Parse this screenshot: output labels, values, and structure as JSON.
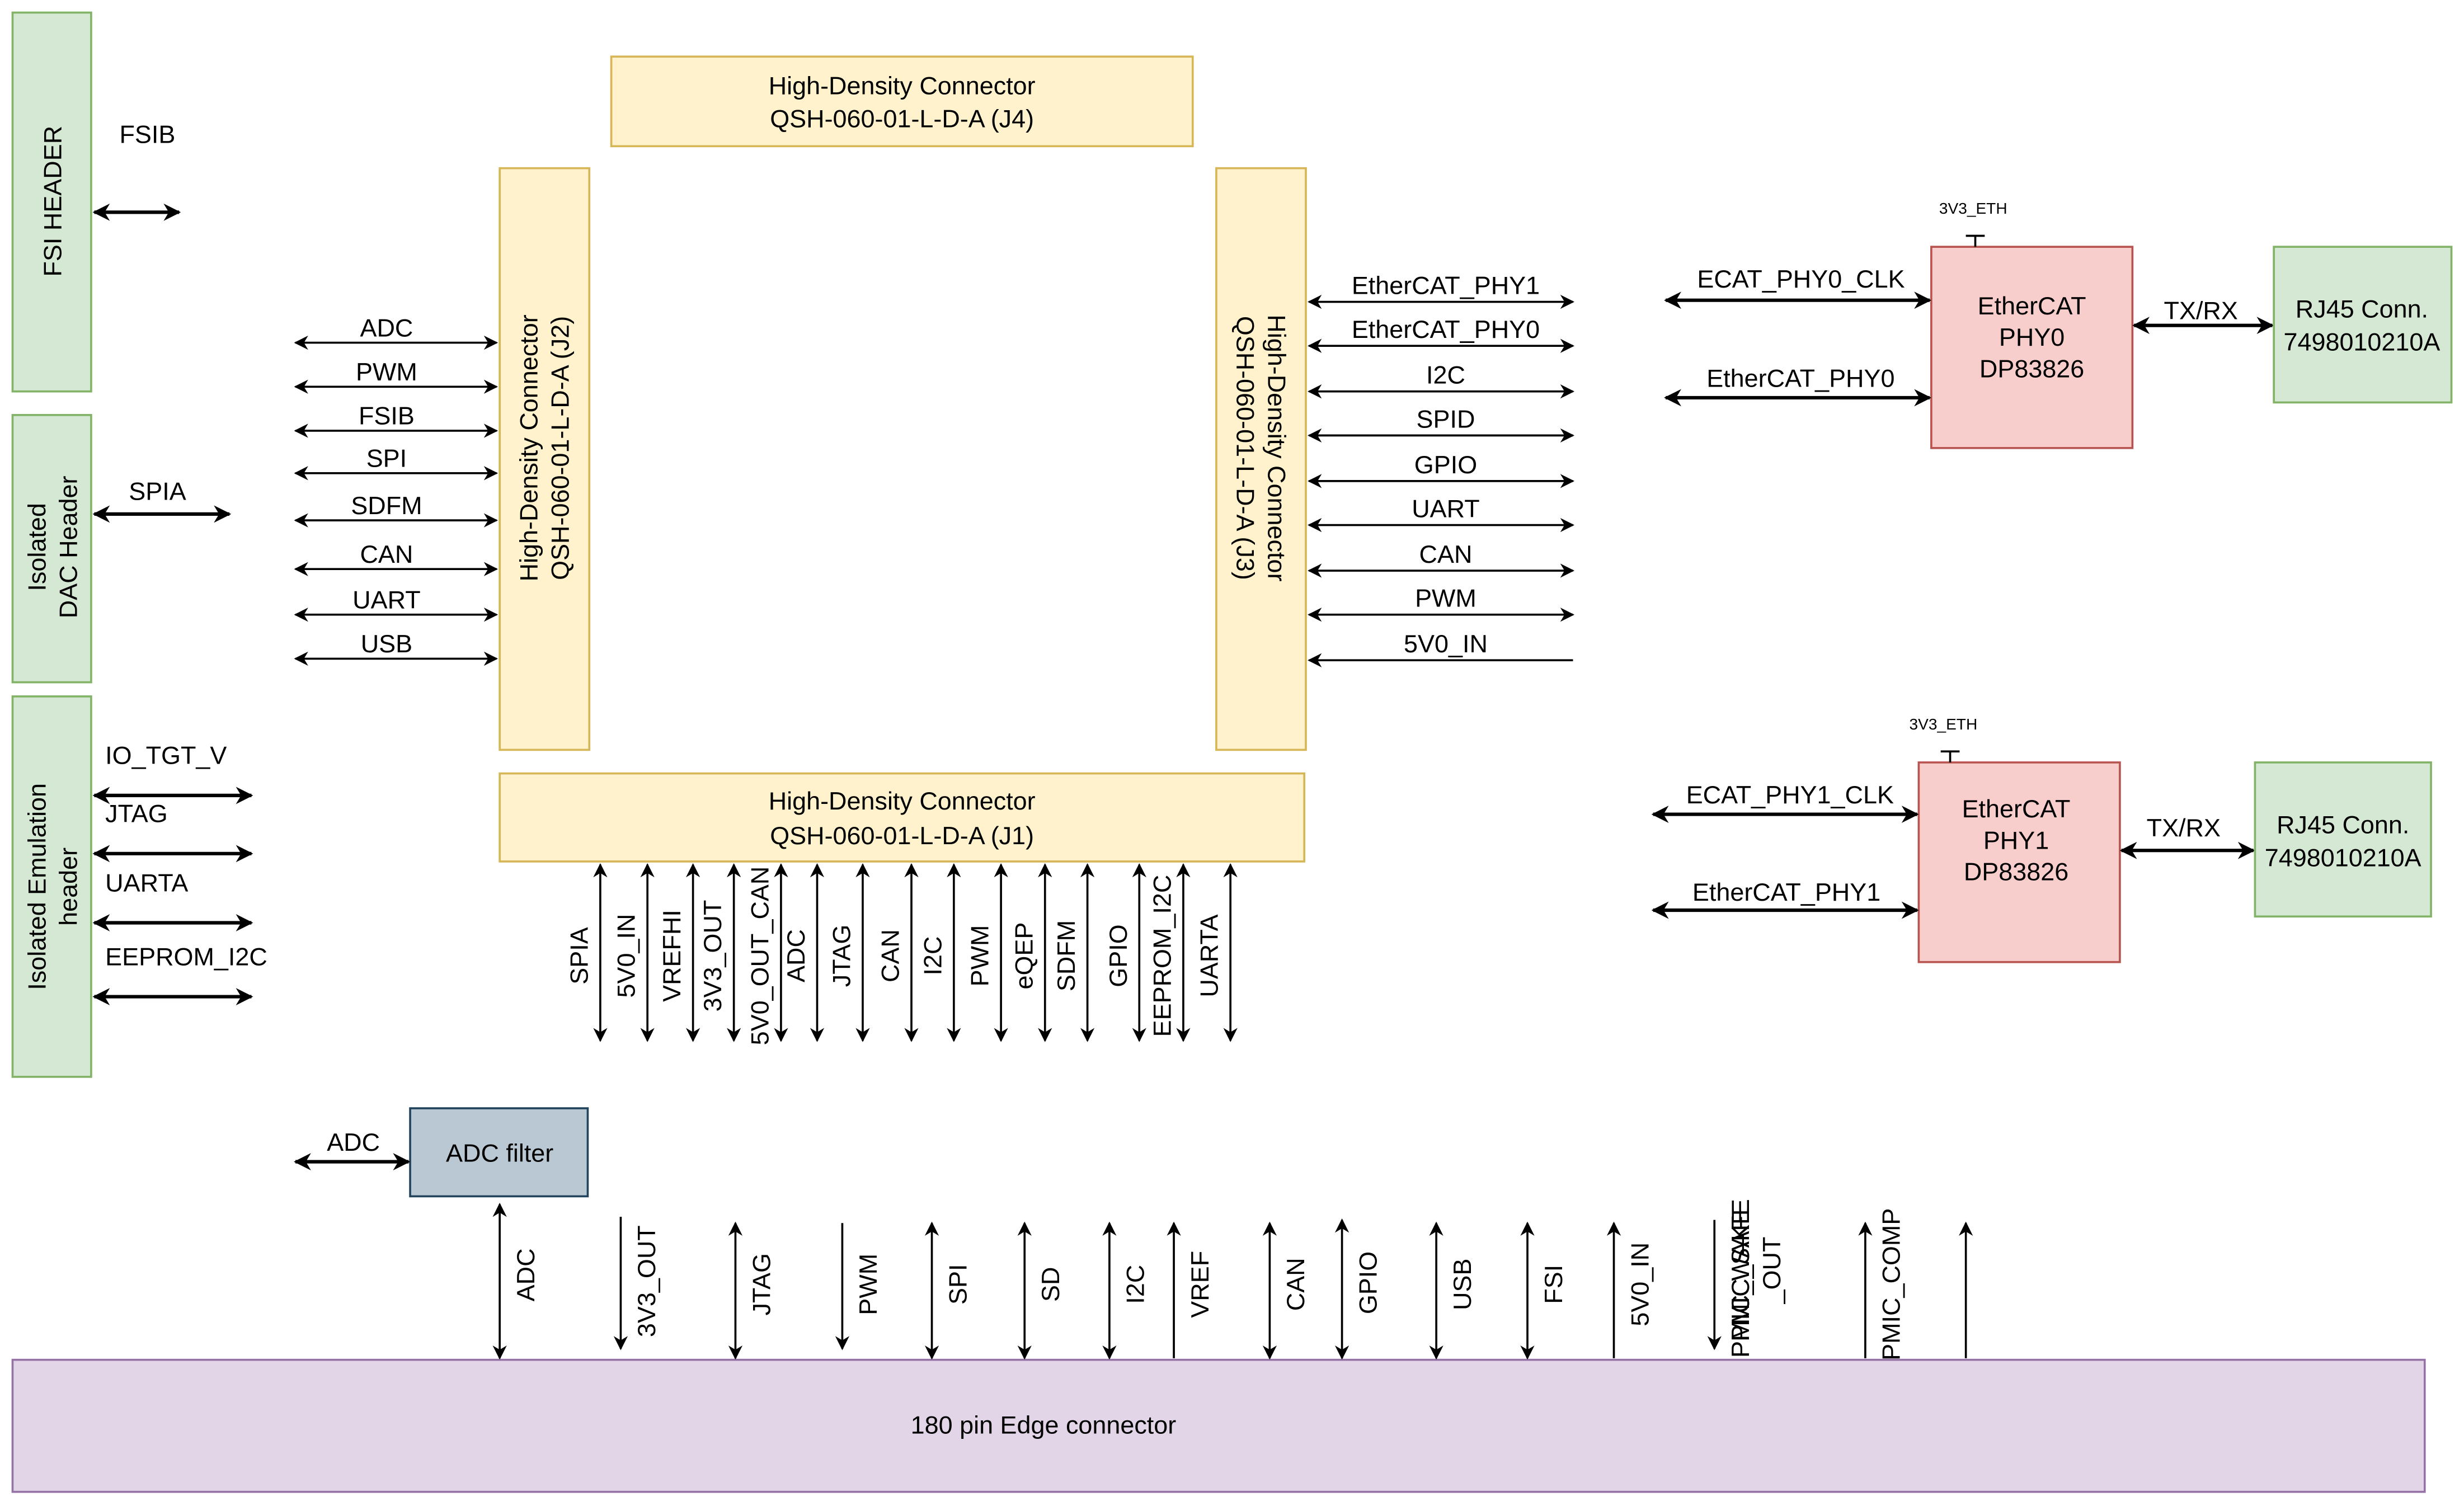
{
  "blocks": {
    "fsi_header": "FSI HEADER",
    "dac_header": [
      "Isolated",
      "DAC Header"
    ],
    "emu_header": [
      "Isolated Emulation",
      "header"
    ],
    "j4": [
      "High-Density Connector",
      "QSH-060-01-L-D-A (J4)"
    ],
    "j2": [
      "High-Density Connector",
      "QSH-060-01-L-D-A (J2)"
    ],
    "j3": [
      "High-Density Connector",
      "QSH-060-01-L-D-A (J3)"
    ],
    "j1": [
      "High-Density Connector",
      "QSH-060-01-L-D-A (J1)"
    ],
    "phy0": [
      "EtherCAT",
      "PHY0",
      "DP83826"
    ],
    "phy1": [
      "EtherCAT",
      "PHY1",
      "DP83826"
    ],
    "rj45_0": [
      "RJ45 Conn.",
      "7498010210A"
    ],
    "rj45_1": [
      "RJ45 Conn.",
      "7498010210A"
    ],
    "adc_filter": "ADC filter",
    "edge_connector": "180 pin Edge connector"
  },
  "signals": {
    "fsi_header": "FSIB",
    "dac_header": "SPIA",
    "emu_header": [
      "IO_TGT_V",
      "JTAG",
      "UARTA",
      "EEPROM_I2C"
    ],
    "j2": [
      "ADC",
      "PWM",
      "FSIB",
      "SPI",
      "SDFM",
      "CAN",
      "UART",
      "USB"
    ],
    "j3": [
      "EtherCAT_PHY1",
      "EtherCAT_PHY0",
      "I2C",
      "SPID",
      "GPIO",
      "UART",
      "CAN",
      "PWM",
      "5V0_IN"
    ],
    "j1": [
      "SPIA",
      "5V0_IN",
      "VREFHI",
      "3V3_OUT",
      "5V0_OUT_CAN",
      "ADC",
      "JTAG",
      "CAN",
      "I2C",
      "PWM",
      "eQEP",
      "SDFM",
      "GPIO",
      "EEPROM_I2C",
      "UARTA"
    ],
    "phy0": [
      "ECAT_PHY0_CLK",
      "EtherCAT_PHY0"
    ],
    "phy1": [
      "ECAT_PHY1_CLK",
      "EtherCAT_PHY1"
    ],
    "phy_power": "3V3_ETH",
    "tx_rx": "TX/RX",
    "adc_filter_in": "ADC",
    "edge": [
      "ADC",
      "3V3_OUT",
      "JTAG",
      "PWM",
      "SPI",
      "SD",
      "I2C",
      "VREF",
      "CAN",
      "GPIO",
      "USB",
      "FSI",
      "5V0_IN",
      "PMIC_SAFE_OUT",
      "PMIC_WAKE",
      "PMIC_COMP"
    ]
  },
  "colors": {
    "header_green": "#d5e8d4",
    "connector_yellow": "#fff2cc",
    "phy_red": "#f8cecc",
    "filter_blue": "#bac8d3",
    "edge_purple": "#e1d5e7"
  }
}
